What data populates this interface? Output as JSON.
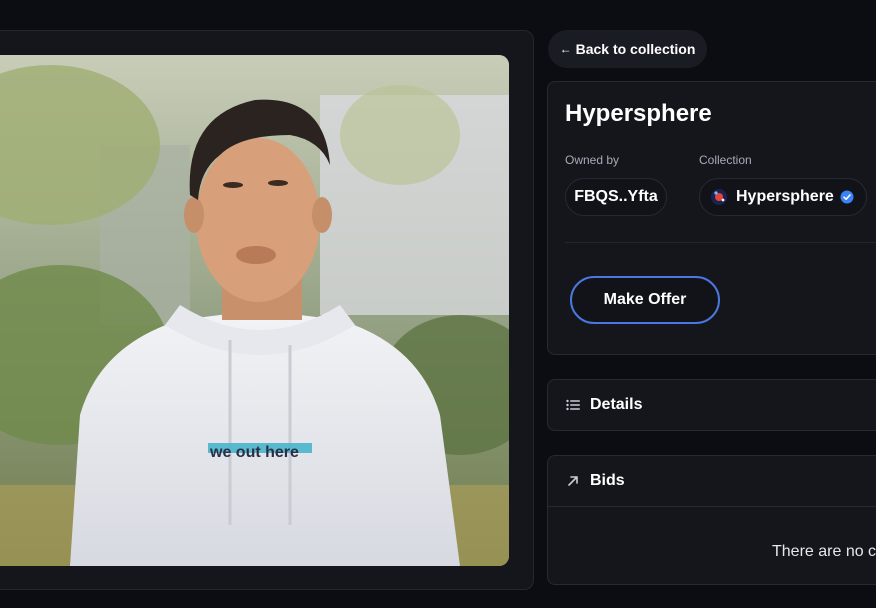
{
  "nav": {
    "back_label": "Back to collection"
  },
  "nft": {
    "title": "Hypersphere",
    "image_caption": "we out here"
  },
  "ownership": {
    "owned_by_label": "Owned by",
    "owner": "FBQS..Yfta",
    "collection_label": "Collection",
    "collection": "Hypersphere"
  },
  "actions": {
    "make_offer_label": "Make Offer"
  },
  "details": {
    "label": "Details"
  },
  "bids": {
    "label": "Bids",
    "empty_text": "There are no c"
  },
  "colors": {
    "background": "#0c0d12",
    "card": "#14161c",
    "accent": "#4a78e0",
    "verified": "#3b82f6"
  },
  "icons": {
    "back": "arrow-left-icon",
    "collection": "hypersphere-logo-icon",
    "verified": "verified-badge-icon",
    "details": "list-icon",
    "bids": "arrow-up-right-icon"
  }
}
